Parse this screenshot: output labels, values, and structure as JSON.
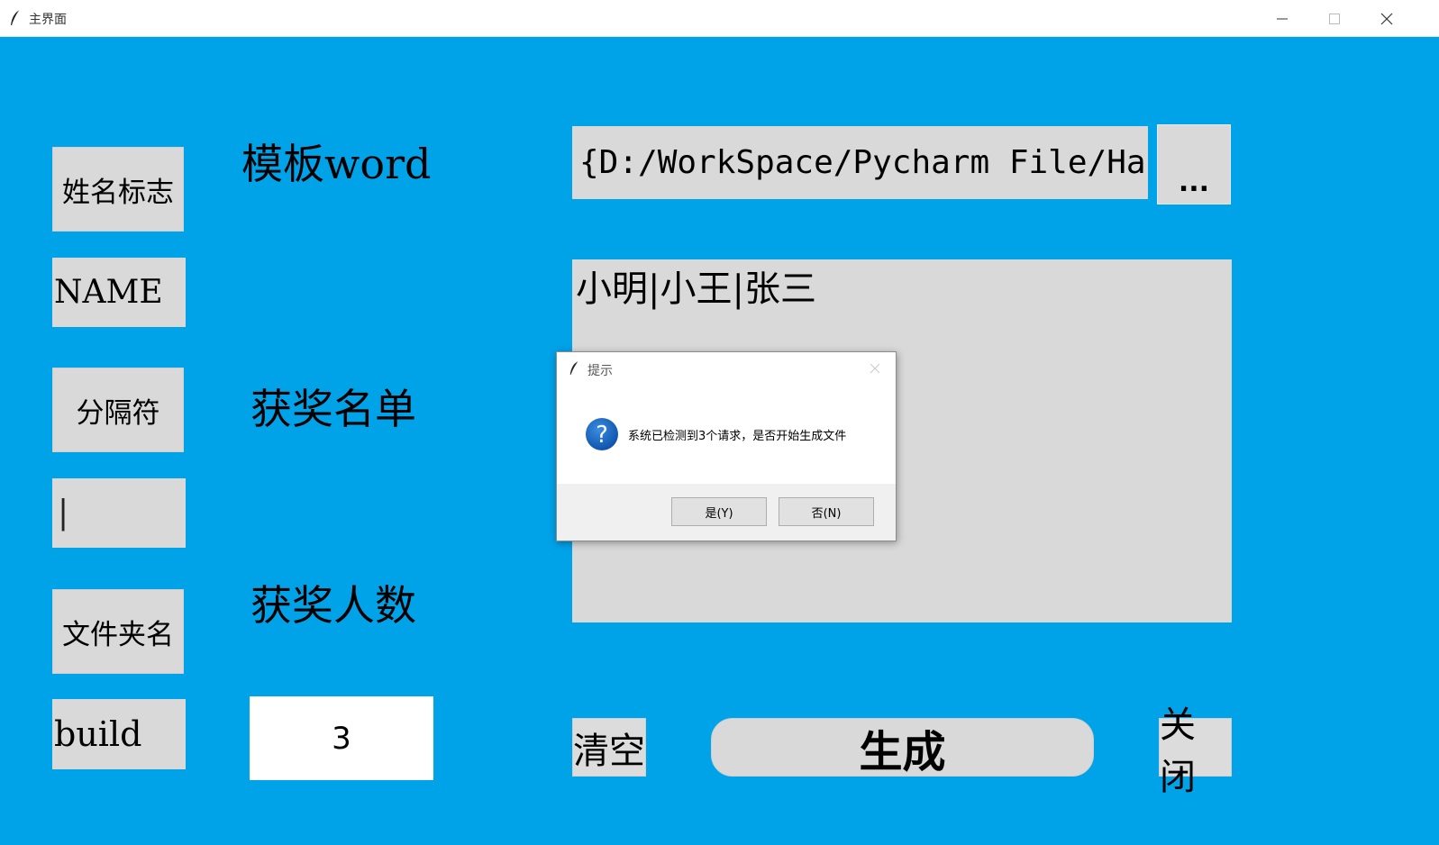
{
  "window": {
    "title": "主界面",
    "bg_color": "#00a2e8"
  },
  "left": {
    "name_flag_button": "姓名标志",
    "name_flag_value": "NAME",
    "separator_button": "分隔符",
    "separator_value": "|",
    "folder_button": "文件夹名",
    "folder_value": "build"
  },
  "middle": {
    "template_label": "模板word",
    "winners_label": "获奖名单",
    "count_label": "获奖人数",
    "count_value": "3"
  },
  "right": {
    "template_path": "{D:/WorkSpace/Pycharm File/Hand",
    "browse_label": "...",
    "winners_text": "小明|小王|张三"
  },
  "bottom": {
    "clear_label": "清空",
    "generate_label": "生成",
    "close_label": "关闭"
  },
  "dialog": {
    "title": "提示",
    "message": "系统已检测到3个请求，是否开始生成文件",
    "yes_label": "是(Y)",
    "no_label": "否(N)",
    "icon": "question-icon"
  }
}
